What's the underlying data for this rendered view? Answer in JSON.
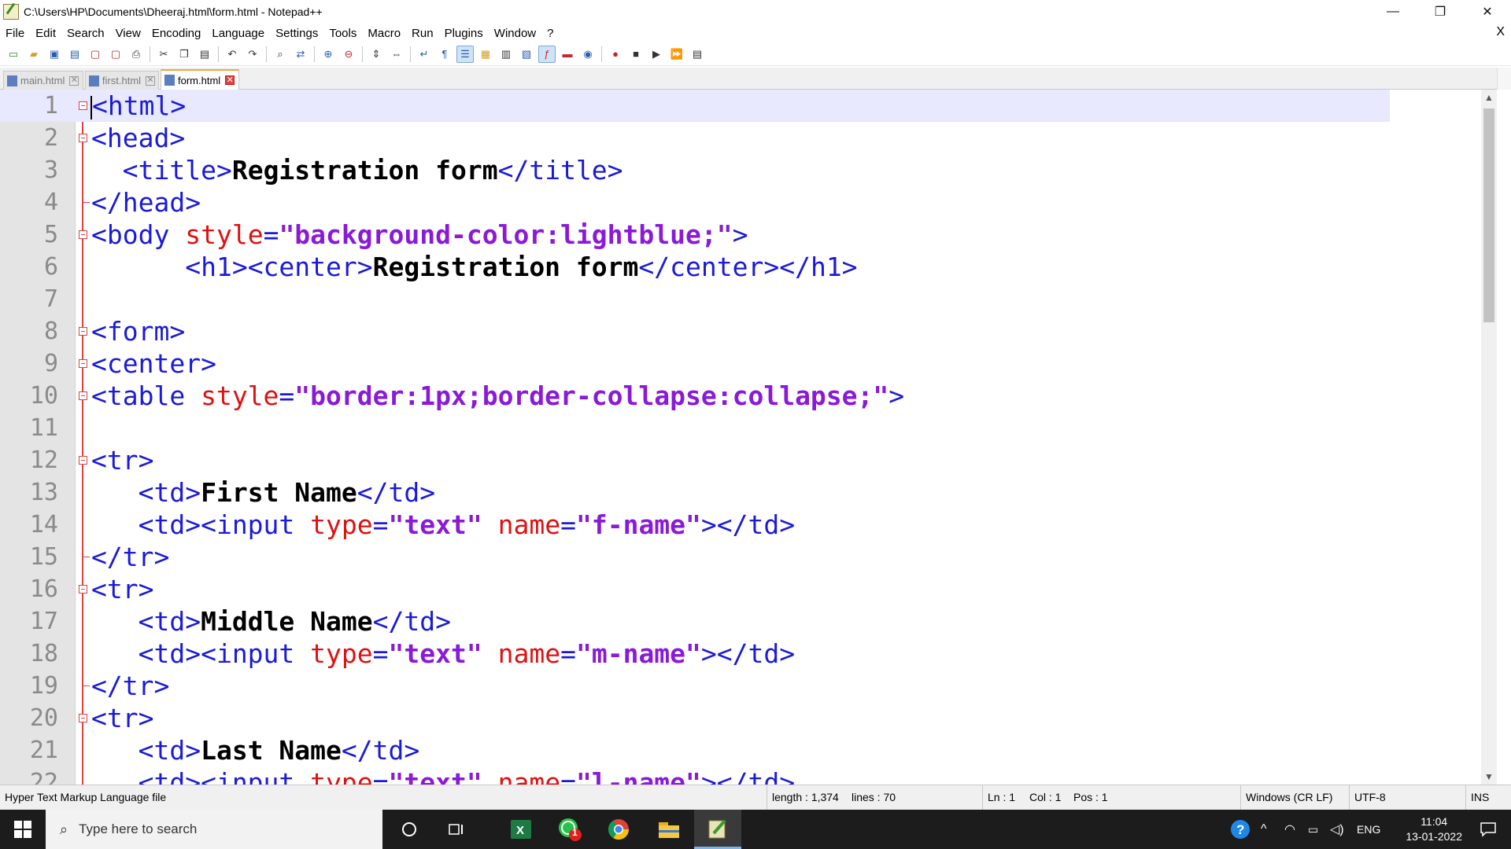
{
  "window": {
    "title": "C:\\Users\\HP\\Documents\\Dheeraj.html\\form.html - Notepad++",
    "minimize": "—",
    "maximize": "❐",
    "close": "✕"
  },
  "menu": [
    "File",
    "Edit",
    "Search",
    "View",
    "Encoding",
    "Language",
    "Settings",
    "Tools",
    "Macro",
    "Run",
    "Plugins",
    "Window",
    "?"
  ],
  "menu_close": "X",
  "tabs": [
    {
      "label": "main.html",
      "active": false
    },
    {
      "label": "first.html",
      "active": false
    },
    {
      "label": "form.html",
      "active": true
    }
  ],
  "code_lines": [
    {
      "n": "1",
      "parts": [
        [
          "tag",
          "<html>"
        ]
      ]
    },
    {
      "n": "2",
      "parts": [
        [
          "tag",
          "<head>"
        ]
      ]
    },
    {
      "n": "3",
      "parts": [
        [
          "sp",
          "  "
        ],
        [
          "tag",
          "<title>"
        ],
        [
          "txt",
          "Registration form"
        ],
        [
          "tag",
          "</title>"
        ]
      ]
    },
    {
      "n": "4",
      "parts": [
        [
          "tag",
          "</head>"
        ]
      ]
    },
    {
      "n": "5",
      "parts": [
        [
          "tag",
          "<body "
        ],
        [
          "attr",
          "style"
        ],
        [
          "tag",
          "="
        ],
        [
          "val",
          "\"background-color:lightblue;\""
        ],
        [
          "tag",
          ">"
        ]
      ]
    },
    {
      "n": "6",
      "parts": [
        [
          "sp",
          "      "
        ],
        [
          "tag",
          "<h1><center>"
        ],
        [
          "txt",
          "Registration form"
        ],
        [
          "tag",
          "</center></h1>"
        ]
      ]
    },
    {
      "n": "7",
      "parts": []
    },
    {
      "n": "8",
      "parts": [
        [
          "tag",
          "<form>"
        ]
      ]
    },
    {
      "n": "9",
      "parts": [
        [
          "tag",
          "<center>"
        ]
      ]
    },
    {
      "n": "10",
      "parts": [
        [
          "tag",
          "<table "
        ],
        [
          "attr",
          "style"
        ],
        [
          "tag",
          "="
        ],
        [
          "val",
          "\"border:1px;border-collapse:collapse;\""
        ],
        [
          "tag",
          ">"
        ]
      ]
    },
    {
      "n": "11",
      "parts": []
    },
    {
      "n": "12",
      "parts": [
        [
          "tag",
          "<tr>"
        ]
      ]
    },
    {
      "n": "13",
      "parts": [
        [
          "sp",
          "   "
        ],
        [
          "tag",
          "<td>"
        ],
        [
          "txt",
          "First Name"
        ],
        [
          "tag",
          "</td>"
        ]
      ]
    },
    {
      "n": "14",
      "parts": [
        [
          "sp",
          "   "
        ],
        [
          "tag",
          "<td><input "
        ],
        [
          "attr",
          "type"
        ],
        [
          "tag",
          "="
        ],
        [
          "val",
          "\"text\""
        ],
        [
          "tag",
          " "
        ],
        [
          "attr",
          "name"
        ],
        [
          "tag",
          "="
        ],
        [
          "val",
          "\"f-name\""
        ],
        [
          "tag",
          "></td>"
        ]
      ]
    },
    {
      "n": "15",
      "parts": [
        [
          "tag",
          "</tr>"
        ]
      ]
    },
    {
      "n": "16",
      "parts": [
        [
          "tag",
          "<tr>"
        ]
      ]
    },
    {
      "n": "17",
      "parts": [
        [
          "sp",
          "   "
        ],
        [
          "tag",
          "<td>"
        ],
        [
          "txt",
          "Middle Name"
        ],
        [
          "tag",
          "</td>"
        ]
      ]
    },
    {
      "n": "18",
      "parts": [
        [
          "sp",
          "   "
        ],
        [
          "tag",
          "<td><input "
        ],
        [
          "attr",
          "type"
        ],
        [
          "tag",
          "="
        ],
        [
          "val",
          "\"text\""
        ],
        [
          "tag",
          " "
        ],
        [
          "attr",
          "name"
        ],
        [
          "tag",
          "="
        ],
        [
          "val",
          "\"m-name\""
        ],
        [
          "tag",
          "></td>"
        ]
      ]
    },
    {
      "n": "19",
      "parts": [
        [
          "tag",
          "</tr>"
        ]
      ]
    },
    {
      "n": "20",
      "parts": [
        [
          "tag",
          "<tr>"
        ]
      ]
    },
    {
      "n": "21",
      "parts": [
        [
          "sp",
          "   "
        ],
        [
          "tag",
          "<td>"
        ],
        [
          "txt",
          "Last Name"
        ],
        [
          "tag",
          "</td>"
        ]
      ]
    },
    {
      "n": "22",
      "parts": [
        [
          "sp",
          "   "
        ],
        [
          "tag",
          "<td><input "
        ],
        [
          "attr",
          "type"
        ],
        [
          "tag",
          "="
        ],
        [
          "val",
          "\"text\""
        ],
        [
          "tag",
          " "
        ],
        [
          "attr",
          "name"
        ],
        [
          "tag",
          "="
        ],
        [
          "val",
          "\"l-name\""
        ],
        [
          "tag",
          "></td>"
        ]
      ]
    }
  ],
  "status": {
    "file_type": "Hyper Text Markup Language file",
    "length": "length : 1,374",
    "lines": "lines : 70",
    "ln": "Ln : 1",
    "col": "Col : 1",
    "pos": "Pos : 1",
    "eol": "Windows (CR LF)",
    "encoding": "UTF-8",
    "mode": "INS"
  },
  "taskbar": {
    "search_placeholder": "Type here to search",
    "whatsapp_badge": "1",
    "language": "ENG",
    "time": "11:04",
    "date": "13-01-2022"
  },
  "colors": {
    "tag": "#1a1ad8",
    "attribute": "#e01010",
    "value": "#8a1ad8",
    "current_line": "#e8e8ff",
    "gutter": "#e4e4e4"
  }
}
